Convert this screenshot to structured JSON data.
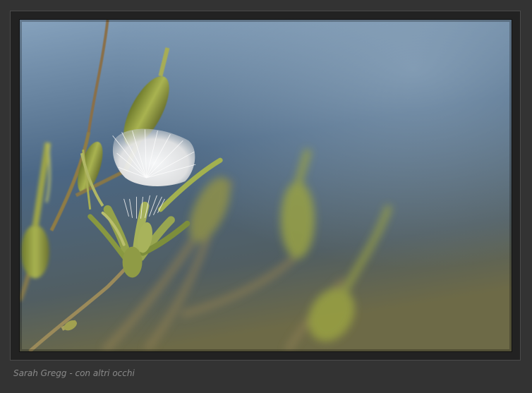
{
  "caption": {
    "text": "Sarah Gregg - con altri occhi"
  },
  "photo": {
    "subject": "dandelion-seed-head-on-stem",
    "colors": {
      "sky_top": "#7e9bb8",
      "sky_mid": "#4f6b86",
      "sky_bottom": "#6b6f52",
      "stem": "#8a7a4a",
      "bud": "#9aa84a",
      "seed": "#f4f4f4"
    }
  },
  "colors": {
    "background": "#333333",
    "frame_border": "#4a4a4a",
    "caption_text": "#8a8a8a"
  }
}
